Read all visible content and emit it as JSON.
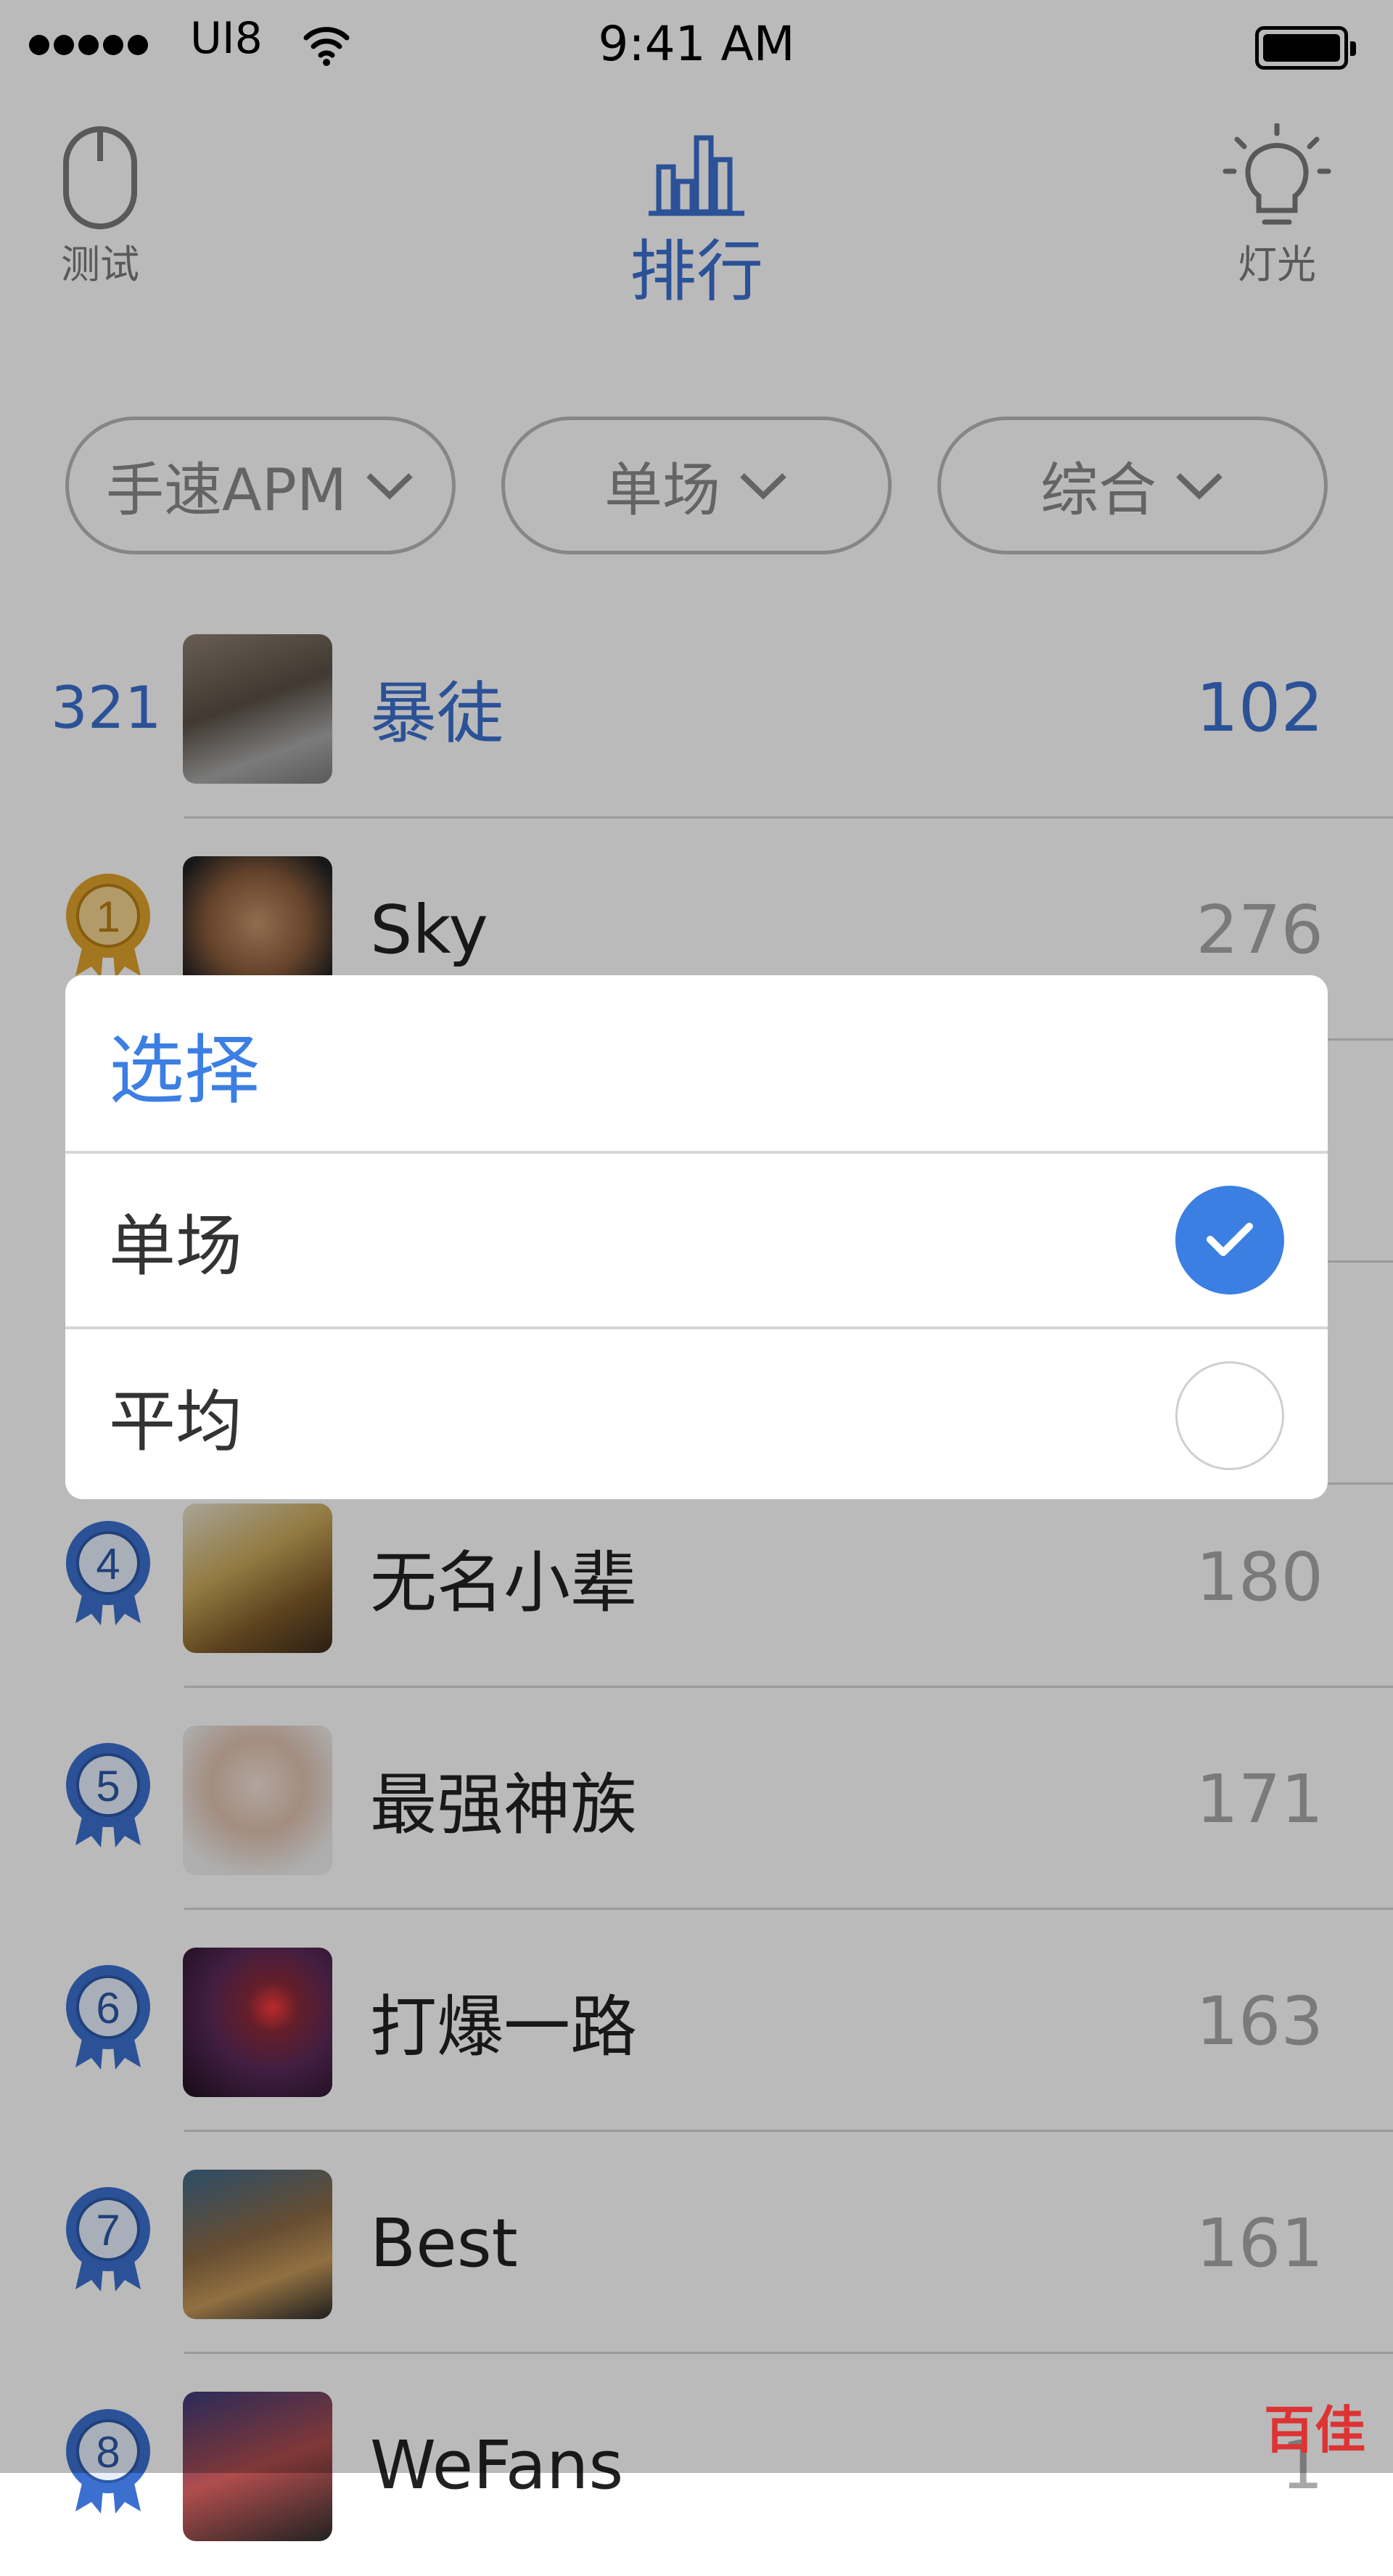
{
  "status_bar": {
    "carrier": "UI8",
    "time": "9:41 AM"
  },
  "nav": {
    "left_label": "测试",
    "center_label": "排行",
    "right_label": "灯光"
  },
  "filters": [
    {
      "label": "手速APM"
    },
    {
      "label": "单场"
    },
    {
      "label": "综合"
    }
  ],
  "leaderboard": {
    "me": {
      "rank": "321",
      "name": "暴徒",
      "score": "102"
    },
    "rows": [
      {
        "rank": "1",
        "name": "Sky",
        "score": "276",
        "medal_color": "gold"
      },
      {
        "rank": "4",
        "name": "无名小辈",
        "score": "180",
        "medal_color": "blue"
      },
      {
        "rank": "5",
        "name": "最强神族",
        "score": "171",
        "medal_color": "blue"
      },
      {
        "rank": "6",
        "name": "打爆一路",
        "score": "163",
        "medal_color": "blue"
      },
      {
        "rank": "7",
        "name": "Best",
        "score": "161",
        "medal_color": "blue"
      },
      {
        "rank": "8",
        "name": "WeFans",
        "score": "1",
        "medal_color": "blue"
      }
    ]
  },
  "modal": {
    "title": "选择",
    "options": [
      {
        "label": "单场",
        "selected": true
      },
      {
        "label": "平均",
        "selected": false
      }
    ]
  },
  "watermark": "百佳",
  "colors": {
    "accent": "#3b6fd0",
    "modal_accent": "#3b7fe3",
    "gold": "#e0a22d"
  }
}
